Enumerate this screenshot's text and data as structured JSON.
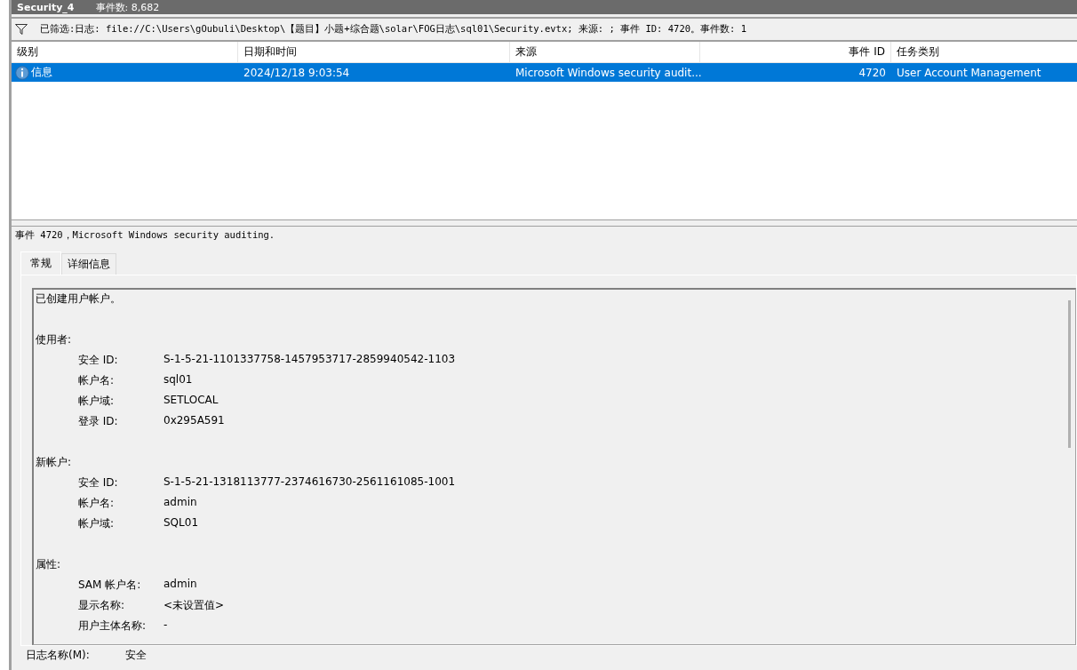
{
  "window": {
    "title": "Security_4",
    "event_count": "事件数: 8,682"
  },
  "filter": {
    "text": "已筛选:日志: file://C:\\Users\\gOubuli\\Desktop\\【题目】小题+综合题\\solar\\FOG日志\\sql01\\Security.evtx; 来源: ; 事件 ID: 4720。事件数: 1"
  },
  "table": {
    "columns": [
      "级别",
      "日期和时间",
      "来源",
      "事件 ID",
      "任务类别"
    ],
    "rows": [
      {
        "selected": true,
        "level": "信息",
        "date": "2024/12/18 9:03:54",
        "source": "Microsoft Windows security audit...",
        "event_id": "4720",
        "task": "User Account Management"
      }
    ]
  },
  "details": {
    "header": "事件 4720，Microsoft Windows security auditing.",
    "tabs": [
      {
        "label": "常规",
        "selected": true
      },
      {
        "label": "详细信息",
        "selected": false
      }
    ],
    "description": "已创建用户帐户。",
    "sections": [
      {
        "title": "使用者:",
        "fields": [
          {
            "label": "安全 ID:",
            "value": "S-1-5-21-1101337758-1457953717-2859940542-1103"
          },
          {
            "label": "帐户名:",
            "value": "sql01"
          },
          {
            "label": "帐户域:",
            "value": "SETLOCAL"
          },
          {
            "label": "登录 ID:",
            "value": "0x295A591"
          }
        ]
      },
      {
        "title": "新帐户:",
        "fields": [
          {
            "label": "安全 ID:",
            "value": "S-1-5-21-1318113777-2374616730-2561161085-1001"
          },
          {
            "label": "帐户名:",
            "value": "admin"
          },
          {
            "label": "帐户域:",
            "value": "SQL01"
          }
        ]
      },
      {
        "title": "属性:",
        "fields": [
          {
            "label": "SAM 帐户名:",
            "value": "admin"
          },
          {
            "label": "显示名称:",
            "value": "<未设置值>"
          },
          {
            "label": "用户主体名称:",
            "value": "-"
          }
        ]
      }
    ]
  },
  "footer": [
    {
      "label": "日志名称(M):",
      "value": "安全"
    }
  ]
}
